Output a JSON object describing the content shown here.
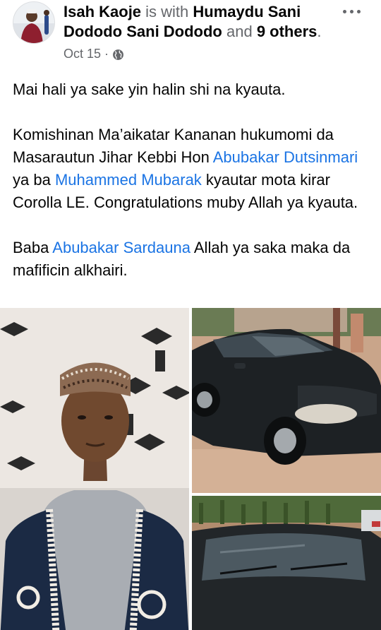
{
  "post": {
    "author": "Isah Kaoje",
    "with_text": " is with ",
    "tagged_1": "Humaydu Sani Dododo",
    "tagged_2": "Sani Dododo",
    "and_text": " and ",
    "others": "9 others",
    "period": ".",
    "date": "Oct 15",
    "separator": "·",
    "privacy_icon": "globe-icon",
    "more_icon": "more-options-icon"
  },
  "body": {
    "paragraph_1": "Mai hali ya sake yin halin shi na kyauta.",
    "paragraph_2": {
      "part_1": "Komishinan Ma’aikatar Kananan hukumomi da Masarautun Jihar Kebbi Hon ",
      "mention_1": "Abubakar Dutsinmari",
      "part_2": " ya ba ",
      "mention_2": "Muhammed Mubarak",
      "part_3": " kyautar mota kirar Corolla LE. Congratulations muby Allah ya kyauta."
    },
    "paragraph_3": {
      "part_1": "Baba ",
      "mention_1": "Abubakar Sardauna",
      "part_2": " Allah ya saka maka da mafificin alkhairi."
    }
  },
  "colors": {
    "mention": "#1b74e4",
    "secondary_text": "#65676b",
    "primary_text": "#050505"
  }
}
